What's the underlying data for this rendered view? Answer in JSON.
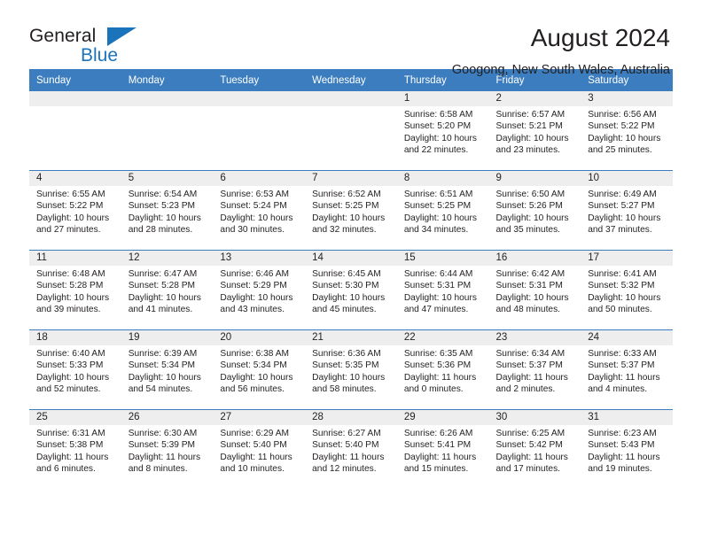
{
  "brand": {
    "name_part1": "General",
    "name_part2": "Blue",
    "accent_color": "#1b74bb"
  },
  "header": {
    "title": "August 2024",
    "location": "Googong, New South Wales, Australia"
  },
  "calendar": {
    "header_color": "#3b7dbe",
    "weekdays": [
      "Sunday",
      "Monday",
      "Tuesday",
      "Wednesday",
      "Thursday",
      "Friday",
      "Saturday"
    ],
    "weeks": [
      [
        {
          "day": "",
          "lines": []
        },
        {
          "day": "",
          "lines": []
        },
        {
          "day": "",
          "lines": []
        },
        {
          "day": "",
          "lines": []
        },
        {
          "day": "1",
          "lines": [
            "Sunrise: 6:58 AM",
            "Sunset: 5:20 PM",
            "Daylight: 10 hours",
            "and 22 minutes."
          ]
        },
        {
          "day": "2",
          "lines": [
            "Sunrise: 6:57 AM",
            "Sunset: 5:21 PM",
            "Daylight: 10 hours",
            "and 23 minutes."
          ]
        },
        {
          "day": "3",
          "lines": [
            "Sunrise: 6:56 AM",
            "Sunset: 5:22 PM",
            "Daylight: 10 hours",
            "and 25 minutes."
          ]
        }
      ],
      [
        {
          "day": "4",
          "lines": [
            "Sunrise: 6:55 AM",
            "Sunset: 5:22 PM",
            "Daylight: 10 hours",
            "and 27 minutes."
          ]
        },
        {
          "day": "5",
          "lines": [
            "Sunrise: 6:54 AM",
            "Sunset: 5:23 PM",
            "Daylight: 10 hours",
            "and 28 minutes."
          ]
        },
        {
          "day": "6",
          "lines": [
            "Sunrise: 6:53 AM",
            "Sunset: 5:24 PM",
            "Daylight: 10 hours",
            "and 30 minutes."
          ]
        },
        {
          "day": "7",
          "lines": [
            "Sunrise: 6:52 AM",
            "Sunset: 5:25 PM",
            "Daylight: 10 hours",
            "and 32 minutes."
          ]
        },
        {
          "day": "8",
          "lines": [
            "Sunrise: 6:51 AM",
            "Sunset: 5:25 PM",
            "Daylight: 10 hours",
            "and 34 minutes."
          ]
        },
        {
          "day": "9",
          "lines": [
            "Sunrise: 6:50 AM",
            "Sunset: 5:26 PM",
            "Daylight: 10 hours",
            "and 35 minutes."
          ]
        },
        {
          "day": "10",
          "lines": [
            "Sunrise: 6:49 AM",
            "Sunset: 5:27 PM",
            "Daylight: 10 hours",
            "and 37 minutes."
          ]
        }
      ],
      [
        {
          "day": "11",
          "lines": [
            "Sunrise: 6:48 AM",
            "Sunset: 5:28 PM",
            "Daylight: 10 hours",
            "and 39 minutes."
          ]
        },
        {
          "day": "12",
          "lines": [
            "Sunrise: 6:47 AM",
            "Sunset: 5:28 PM",
            "Daylight: 10 hours",
            "and 41 minutes."
          ]
        },
        {
          "day": "13",
          "lines": [
            "Sunrise: 6:46 AM",
            "Sunset: 5:29 PM",
            "Daylight: 10 hours",
            "and 43 minutes."
          ]
        },
        {
          "day": "14",
          "lines": [
            "Sunrise: 6:45 AM",
            "Sunset: 5:30 PM",
            "Daylight: 10 hours",
            "and 45 minutes."
          ]
        },
        {
          "day": "15",
          "lines": [
            "Sunrise: 6:44 AM",
            "Sunset: 5:31 PM",
            "Daylight: 10 hours",
            "and 47 minutes."
          ]
        },
        {
          "day": "16",
          "lines": [
            "Sunrise: 6:42 AM",
            "Sunset: 5:31 PM",
            "Daylight: 10 hours",
            "and 48 minutes."
          ]
        },
        {
          "day": "17",
          "lines": [
            "Sunrise: 6:41 AM",
            "Sunset: 5:32 PM",
            "Daylight: 10 hours",
            "and 50 minutes."
          ]
        }
      ],
      [
        {
          "day": "18",
          "lines": [
            "Sunrise: 6:40 AM",
            "Sunset: 5:33 PM",
            "Daylight: 10 hours",
            "and 52 minutes."
          ]
        },
        {
          "day": "19",
          "lines": [
            "Sunrise: 6:39 AM",
            "Sunset: 5:34 PM",
            "Daylight: 10 hours",
            "and 54 minutes."
          ]
        },
        {
          "day": "20",
          "lines": [
            "Sunrise: 6:38 AM",
            "Sunset: 5:34 PM",
            "Daylight: 10 hours",
            "and 56 minutes."
          ]
        },
        {
          "day": "21",
          "lines": [
            "Sunrise: 6:36 AM",
            "Sunset: 5:35 PM",
            "Daylight: 10 hours",
            "and 58 minutes."
          ]
        },
        {
          "day": "22",
          "lines": [
            "Sunrise: 6:35 AM",
            "Sunset: 5:36 PM",
            "Daylight: 11 hours",
            "and 0 minutes."
          ]
        },
        {
          "day": "23",
          "lines": [
            "Sunrise: 6:34 AM",
            "Sunset: 5:37 PM",
            "Daylight: 11 hours",
            "and 2 minutes."
          ]
        },
        {
          "day": "24",
          "lines": [
            "Sunrise: 6:33 AM",
            "Sunset: 5:37 PM",
            "Daylight: 11 hours",
            "and 4 minutes."
          ]
        }
      ],
      [
        {
          "day": "25",
          "lines": [
            "Sunrise: 6:31 AM",
            "Sunset: 5:38 PM",
            "Daylight: 11 hours",
            "and 6 minutes."
          ]
        },
        {
          "day": "26",
          "lines": [
            "Sunrise: 6:30 AM",
            "Sunset: 5:39 PM",
            "Daylight: 11 hours",
            "and 8 minutes."
          ]
        },
        {
          "day": "27",
          "lines": [
            "Sunrise: 6:29 AM",
            "Sunset: 5:40 PM",
            "Daylight: 11 hours",
            "and 10 minutes."
          ]
        },
        {
          "day": "28",
          "lines": [
            "Sunrise: 6:27 AM",
            "Sunset: 5:40 PM",
            "Daylight: 11 hours",
            "and 12 minutes."
          ]
        },
        {
          "day": "29",
          "lines": [
            "Sunrise: 6:26 AM",
            "Sunset: 5:41 PM",
            "Daylight: 11 hours",
            "and 15 minutes."
          ]
        },
        {
          "day": "30",
          "lines": [
            "Sunrise: 6:25 AM",
            "Sunset: 5:42 PM",
            "Daylight: 11 hours",
            "and 17 minutes."
          ]
        },
        {
          "day": "31",
          "lines": [
            "Sunrise: 6:23 AM",
            "Sunset: 5:43 PM",
            "Daylight: 11 hours",
            "and 19 minutes."
          ]
        }
      ]
    ]
  }
}
